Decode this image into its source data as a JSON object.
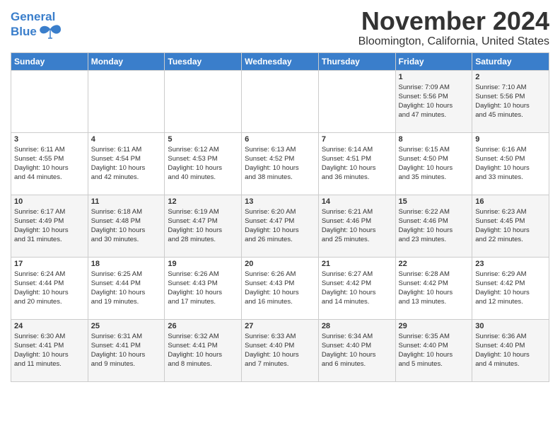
{
  "header": {
    "logo_line1": "General",
    "logo_line2": "Blue",
    "month_title": "November 2024",
    "location": "Bloomington, California, United States"
  },
  "weekdays": [
    "Sunday",
    "Monday",
    "Tuesday",
    "Wednesday",
    "Thursday",
    "Friday",
    "Saturday"
  ],
  "weeks": [
    [
      {
        "day": "",
        "info": ""
      },
      {
        "day": "",
        "info": ""
      },
      {
        "day": "",
        "info": ""
      },
      {
        "day": "",
        "info": ""
      },
      {
        "day": "",
        "info": ""
      },
      {
        "day": "1",
        "info": "Sunrise: 7:09 AM\nSunset: 5:56 PM\nDaylight: 10 hours\nand 47 minutes."
      },
      {
        "day": "2",
        "info": "Sunrise: 7:10 AM\nSunset: 5:56 PM\nDaylight: 10 hours\nand 45 minutes."
      }
    ],
    [
      {
        "day": "3",
        "info": "Sunrise: 6:11 AM\nSunset: 4:55 PM\nDaylight: 10 hours\nand 44 minutes."
      },
      {
        "day": "4",
        "info": "Sunrise: 6:11 AM\nSunset: 4:54 PM\nDaylight: 10 hours\nand 42 minutes."
      },
      {
        "day": "5",
        "info": "Sunrise: 6:12 AM\nSunset: 4:53 PM\nDaylight: 10 hours\nand 40 minutes."
      },
      {
        "day": "6",
        "info": "Sunrise: 6:13 AM\nSunset: 4:52 PM\nDaylight: 10 hours\nand 38 minutes."
      },
      {
        "day": "7",
        "info": "Sunrise: 6:14 AM\nSunset: 4:51 PM\nDaylight: 10 hours\nand 36 minutes."
      },
      {
        "day": "8",
        "info": "Sunrise: 6:15 AM\nSunset: 4:50 PM\nDaylight: 10 hours\nand 35 minutes."
      },
      {
        "day": "9",
        "info": "Sunrise: 6:16 AM\nSunset: 4:50 PM\nDaylight: 10 hours\nand 33 minutes."
      }
    ],
    [
      {
        "day": "10",
        "info": "Sunrise: 6:17 AM\nSunset: 4:49 PM\nDaylight: 10 hours\nand 31 minutes."
      },
      {
        "day": "11",
        "info": "Sunrise: 6:18 AM\nSunset: 4:48 PM\nDaylight: 10 hours\nand 30 minutes."
      },
      {
        "day": "12",
        "info": "Sunrise: 6:19 AM\nSunset: 4:47 PM\nDaylight: 10 hours\nand 28 minutes."
      },
      {
        "day": "13",
        "info": "Sunrise: 6:20 AM\nSunset: 4:47 PM\nDaylight: 10 hours\nand 26 minutes."
      },
      {
        "day": "14",
        "info": "Sunrise: 6:21 AM\nSunset: 4:46 PM\nDaylight: 10 hours\nand 25 minutes."
      },
      {
        "day": "15",
        "info": "Sunrise: 6:22 AM\nSunset: 4:46 PM\nDaylight: 10 hours\nand 23 minutes."
      },
      {
        "day": "16",
        "info": "Sunrise: 6:23 AM\nSunset: 4:45 PM\nDaylight: 10 hours\nand 22 minutes."
      }
    ],
    [
      {
        "day": "17",
        "info": "Sunrise: 6:24 AM\nSunset: 4:44 PM\nDaylight: 10 hours\nand 20 minutes."
      },
      {
        "day": "18",
        "info": "Sunrise: 6:25 AM\nSunset: 4:44 PM\nDaylight: 10 hours\nand 19 minutes."
      },
      {
        "day": "19",
        "info": "Sunrise: 6:26 AM\nSunset: 4:43 PM\nDaylight: 10 hours\nand 17 minutes."
      },
      {
        "day": "20",
        "info": "Sunrise: 6:26 AM\nSunset: 4:43 PM\nDaylight: 10 hours\nand 16 minutes."
      },
      {
        "day": "21",
        "info": "Sunrise: 6:27 AM\nSunset: 4:42 PM\nDaylight: 10 hours\nand 14 minutes."
      },
      {
        "day": "22",
        "info": "Sunrise: 6:28 AM\nSunset: 4:42 PM\nDaylight: 10 hours\nand 13 minutes."
      },
      {
        "day": "23",
        "info": "Sunrise: 6:29 AM\nSunset: 4:42 PM\nDaylight: 10 hours\nand 12 minutes."
      }
    ],
    [
      {
        "day": "24",
        "info": "Sunrise: 6:30 AM\nSunset: 4:41 PM\nDaylight: 10 hours\nand 11 minutes."
      },
      {
        "day": "25",
        "info": "Sunrise: 6:31 AM\nSunset: 4:41 PM\nDaylight: 10 hours\nand 9 minutes."
      },
      {
        "day": "26",
        "info": "Sunrise: 6:32 AM\nSunset: 4:41 PM\nDaylight: 10 hours\nand 8 minutes."
      },
      {
        "day": "27",
        "info": "Sunrise: 6:33 AM\nSunset: 4:40 PM\nDaylight: 10 hours\nand 7 minutes."
      },
      {
        "day": "28",
        "info": "Sunrise: 6:34 AM\nSunset: 4:40 PM\nDaylight: 10 hours\nand 6 minutes."
      },
      {
        "day": "29",
        "info": "Sunrise: 6:35 AM\nSunset: 4:40 PM\nDaylight: 10 hours\nand 5 minutes."
      },
      {
        "day": "30",
        "info": "Sunrise: 6:36 AM\nSunset: 4:40 PM\nDaylight: 10 hours\nand 4 minutes."
      }
    ]
  ]
}
